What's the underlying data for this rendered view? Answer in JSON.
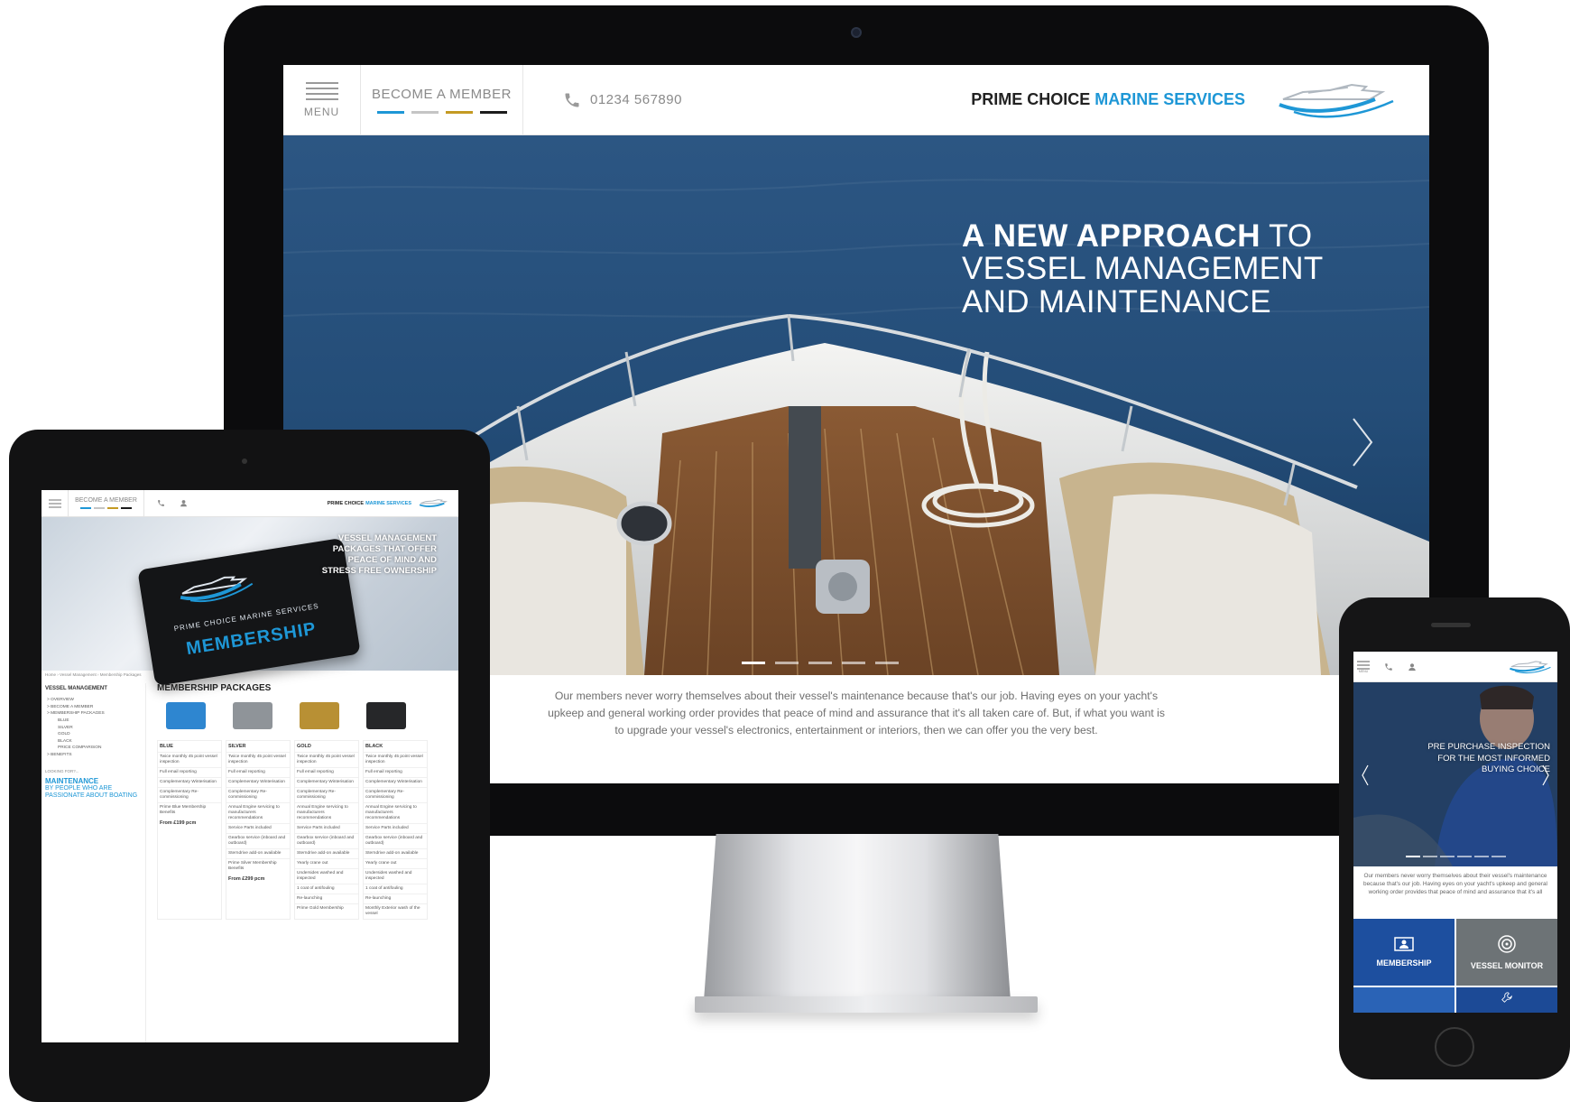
{
  "colors": {
    "accent_blue": "#1e97d6",
    "tier_blue": "#1e97d6",
    "tier_silver": "#c5c5c5",
    "tier_gold": "#c49a23",
    "tier_black": "#1c1c1c",
    "navy_tile": "#1d4f9f"
  },
  "desktop": {
    "nav": {
      "menu_label": "MENU",
      "become_member": "BECOME A MEMBER",
      "phone": "01234 567890",
      "brand_name": "PRIME CHOICE",
      "brand_accent": "MARINE SERVICES"
    },
    "hero": {
      "line1_bold": "A NEW APPROACH",
      "line1_light": " TO",
      "line2": "VESSEL MANAGEMENT",
      "line3": "AND MAINTENANCE",
      "slides": 5,
      "active_slide": 1
    },
    "intro": "Our members never worry themselves about their vessel's maintenance because that's our job. Having eyes on your yacht's upkeep and general working order provides that peace of mind and assurance that it's all taken care of. But, if what you want is to upgrade your vessel's electronics, entertainment or interiors, then we can offer you the very best."
  },
  "tablet": {
    "nav": {
      "become_member": "BECOME A MEMBER",
      "brand_name": "PRIME CHOICE",
      "brand_accent": "MARINE SERVICES"
    },
    "hero": {
      "card_brand": "PRIME CHOICE MARINE SERVICES",
      "card_title": "MEMBERSHIP",
      "text": "VESSEL MANAGEMENT PACKAGES THAT OFFER PEACE OF MIND AND STRESS FREE OWNERSHIP"
    },
    "breadcrumb": "Home › Vessel Management › Membership Packages",
    "sidebar": {
      "title": "VESSEL MANAGEMENT",
      "items": [
        "> OVERVIEW",
        "> BECOME A MEMBER",
        "> MEMBERSHIP PACKAGES"
      ],
      "subitems": [
        "BLUE",
        "SILVER",
        "GOLD",
        "BLACK",
        "PRICE COMPARISON"
      ],
      "benefits": "> BENEFITS",
      "looking_for": "LOOKING FOR?...",
      "promo_title": "MAINTENANCE",
      "promo_sub": "BY PEOPLE WHO ARE PASSIONATE ABOUT BOATING"
    },
    "packages": {
      "title": "MEMBERSHIP PACKAGES",
      "columns": [
        {
          "name": "BLUE",
          "rows": [
            "Twice monthly 45 point vessel inspection",
            "Full email reporting",
            "Complementary Winterisation",
            "Complementary Re-commissioning",
            "Prime Blue Membership Benefits"
          ],
          "price": "From £199 pcm"
        },
        {
          "name": "SILVER",
          "rows": [
            "Twice monthly 45 point vessel inspection",
            "Full email reporting",
            "Complementary Winterisation",
            "Complementary Re-commissioning",
            "Annual Engine servicing to manufacturers recommendations",
            "Service Parts included",
            "Gearbox service (inboard and outboard)",
            "Sterndrive add-on available",
            "Prime Silver Membership Benefits"
          ],
          "price": "From £299 pcm"
        },
        {
          "name": "GOLD",
          "rows": [
            "Twice monthly 45 point vessel inspection",
            "Full email reporting",
            "Complementary Winterisation",
            "Complementary Re-commissioning",
            "Annual Engine servicing to manufacturers recommendations",
            "Service Parts included",
            "Gearbox service (inboard and outboard)",
            "Sterndrive add-on available",
            "Yearly crane out",
            "Undersides washed and inspected",
            "1 coat of antifouling",
            "Re-launching",
            "Prime Gold Membership"
          ],
          "price": ""
        },
        {
          "name": "BLACK",
          "rows": [
            "Twice monthly 45 point vessel inspection",
            "Full email reporting",
            "Complementary Winterisation",
            "Complementary Re-commissioning",
            "Annual Engine servicing to manufacturers recommendations",
            "Service Parts included",
            "Gearbox service (inboard and outboard)",
            "Sterndrive add-on available",
            "Yearly crane out",
            "Undersides washed and inspected",
            "1 coat of antifouling",
            "Re-launching",
            "Monthly Exterior wash of the vessel"
          ],
          "price": ""
        }
      ]
    }
  },
  "phone": {
    "menu_label": "MENU",
    "hero_text": "PRE PURCHASE INSPECTION FOR THE MOST INFORMED BUYING CHOICE",
    "intro": "Our members never worry themselves about their vessel's maintenance because that's our job. Having eyes on your yacht's upkeep and general working order provides that peace of mind and assurance that it's all",
    "tiles": [
      "MEMBERSHIP",
      "VESSEL MONITOR"
    ]
  }
}
